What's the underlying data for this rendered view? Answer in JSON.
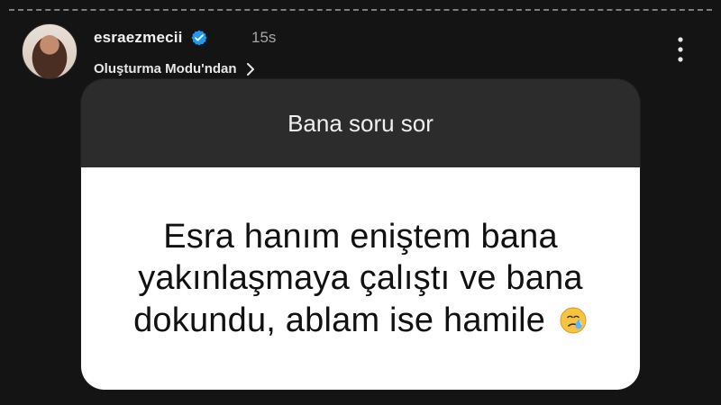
{
  "story": {
    "header": {
      "username": "esraezmecii",
      "verified": true,
      "time": "15s",
      "subtitle": "Oluşturma Modu'ndan"
    },
    "question_box": {
      "prompt": "Bana soru sor",
      "text_lines": [
        "Esra hanım eniştem bana",
        "yakınlaşmaya çalıştı ve bana",
        "dokundu, ablam ise hamile"
      ],
      "trailing_icon": "crying-face-emoji-icon"
    }
  },
  "colors": {
    "background": "#141414",
    "card_header_bg": "#2c2c2c",
    "card_body_bg": "#ffffff",
    "verified_blue": "#1d9bf0"
  }
}
